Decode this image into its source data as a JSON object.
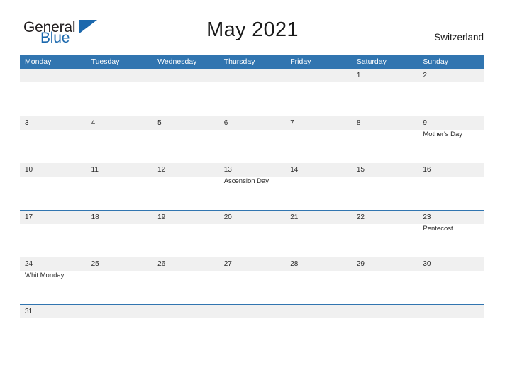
{
  "brand": {
    "name_top": "General",
    "name_bottom": "Blue",
    "triangle_icon": "triangle-icon",
    "color_blue": "#1b68ad"
  },
  "header": {
    "title": "May 2021",
    "country": "Switzerland"
  },
  "theme": {
    "header_blue": "#3175b0",
    "band_gray": "#f0f0f0",
    "text_dark": "#2b2b2b"
  },
  "calendar": {
    "weekdays": [
      "Monday",
      "Tuesday",
      "Wednesday",
      "Thursday",
      "Friday",
      "Saturday",
      "Sunday"
    ],
    "weeks": [
      [
        {
          "day": "",
          "event": ""
        },
        {
          "day": "",
          "event": ""
        },
        {
          "day": "",
          "event": ""
        },
        {
          "day": "",
          "event": ""
        },
        {
          "day": "",
          "event": ""
        },
        {
          "day": "1",
          "event": ""
        },
        {
          "day": "2",
          "event": ""
        }
      ],
      [
        {
          "day": "3",
          "event": ""
        },
        {
          "day": "4",
          "event": ""
        },
        {
          "day": "5",
          "event": ""
        },
        {
          "day": "6",
          "event": ""
        },
        {
          "day": "7",
          "event": ""
        },
        {
          "day": "8",
          "event": ""
        },
        {
          "day": "9",
          "event": "Mother's Day"
        }
      ],
      [
        {
          "day": "10",
          "event": ""
        },
        {
          "day": "11",
          "event": ""
        },
        {
          "day": "12",
          "event": ""
        },
        {
          "day": "13",
          "event": "Ascension Day"
        },
        {
          "day": "14",
          "event": ""
        },
        {
          "day": "15",
          "event": ""
        },
        {
          "day": "16",
          "event": ""
        }
      ],
      [
        {
          "day": "17",
          "event": ""
        },
        {
          "day": "18",
          "event": ""
        },
        {
          "day": "19",
          "event": ""
        },
        {
          "day": "20",
          "event": ""
        },
        {
          "day": "21",
          "event": ""
        },
        {
          "day": "22",
          "event": ""
        },
        {
          "day": "23",
          "event": "Pentecost"
        }
      ],
      [
        {
          "day": "24",
          "event": "Whit Monday"
        },
        {
          "day": "25",
          "event": ""
        },
        {
          "day": "26",
          "event": ""
        },
        {
          "day": "27",
          "event": ""
        },
        {
          "day": "28",
          "event": ""
        },
        {
          "day": "29",
          "event": ""
        },
        {
          "day": "30",
          "event": ""
        }
      ],
      [
        {
          "day": "31",
          "event": ""
        },
        {
          "day": "",
          "event": ""
        },
        {
          "day": "",
          "event": ""
        },
        {
          "day": "",
          "event": ""
        },
        {
          "day": "",
          "event": ""
        },
        {
          "day": "",
          "event": ""
        },
        {
          "day": "",
          "event": ""
        }
      ]
    ]
  }
}
